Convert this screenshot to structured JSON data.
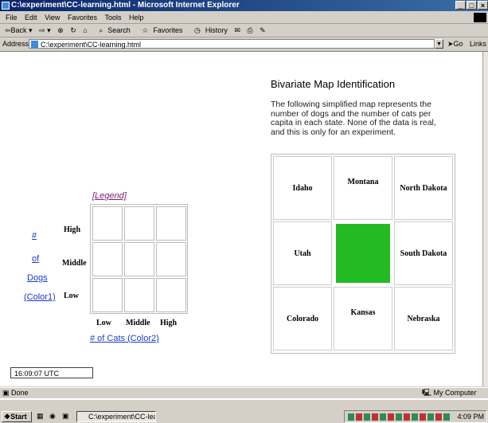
{
  "window": {
    "title": "C:\\experiment\\CC-learning.html - Microsoft Internet Explorer",
    "buttons": [
      "_",
      "□",
      "×"
    ]
  },
  "menu": [
    "File",
    "Edit",
    "View",
    "Favorites",
    "Tools",
    "Help"
  ],
  "toolbar": {
    "back": "⇦Back ▾",
    "forward": "⇨ ▾",
    "search": "Search",
    "favorites": "Favorites",
    "history": "History"
  },
  "address": {
    "label": "Address",
    "value": "C:\\experiment\\CC-learning.html",
    "go": "Go",
    "links": "Links"
  },
  "page": {
    "map_title": "Bivariate Map Identification",
    "map_description": "The following simplified map represents the number of dogs and the number of cats per capita in each state. None of the data is real, and this is only for an experiment.",
    "states": [
      {
        "name": "Idaho",
        "color": "#ffffff"
      },
      {
        "name": "Montana",
        "color": "#ffffff"
      },
      {
        "name": "North Dakota",
        "color": "#ffffff"
      },
      {
        "name": "Utah",
        "color": "#ffffff"
      },
      {
        "name": "",
        "color": "#22bb22"
      },
      {
        "name": "South Dakota",
        "color": "#ffffff"
      },
      {
        "name": "Colorado",
        "color": "#ffffff"
      },
      {
        "name": "Kansas",
        "color": "#ffffff"
      },
      {
        "name": "Nebraska",
        "color": "#ffffff"
      }
    ],
    "legend": {
      "title": "[Legend]",
      "row_labels": [
        "High",
        "Middle",
        "Low"
      ],
      "col_labels": [
        "Low",
        "Middle",
        "High"
      ],
      "y_axis_lines": [
        "#",
        "of",
        "Dogs",
        "(Color1)"
      ],
      "x_axis": "# of Cats (Color2)"
    },
    "time": "16:09:07 UTC"
  },
  "status": {
    "left": "Done",
    "zone": "My Computer"
  },
  "taskbar": {
    "start": "Start",
    "task": "C:\\experiment\\CC-lea...",
    "clock": "4:09 PM"
  }
}
